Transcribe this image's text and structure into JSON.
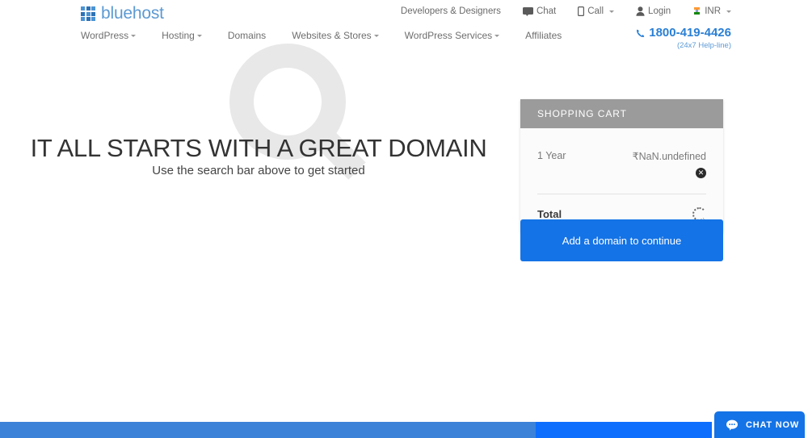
{
  "brand": {
    "name": "bluehost",
    "logo_icon": "grid-squares-icon",
    "accent": "#1473e6",
    "logo_color": "#5c9ad2"
  },
  "top_bar": {
    "items": [
      {
        "label": "Developers & Designers",
        "icon": null,
        "caret": false
      },
      {
        "label": "Chat",
        "icon": "chat-bubble-icon",
        "caret": false
      },
      {
        "label": "Call",
        "icon": "mobile-phone-icon",
        "caret": true
      },
      {
        "label": "Login",
        "icon": "user-person-icon",
        "caret": false
      },
      {
        "label": "INR",
        "icon": "india-flag-icon",
        "caret": true
      }
    ]
  },
  "main_nav": {
    "items": [
      {
        "label": "WordPress",
        "caret": true
      },
      {
        "label": "Hosting",
        "caret": true
      },
      {
        "label": "Domains",
        "caret": false
      },
      {
        "label": "Websites & Stores",
        "caret": true
      },
      {
        "label": "WordPress Services",
        "caret": true
      },
      {
        "label": "Affiliates",
        "caret": false
      }
    ]
  },
  "phone": {
    "icon": "phone-handset-icon",
    "number": "1800-419-4426",
    "subtext": "(24x7 Help-line)",
    "color": "#2a7fd4"
  },
  "hero": {
    "watermark_icon": "magnifying-glass-watermark",
    "title": "IT ALL STARTS WITH A GREAT DOMAIN",
    "subtitle": "Use the search bar above to get started"
  },
  "cart": {
    "header": "SHOPPING CART",
    "header_bg": "#9b9b9b",
    "line_item": {
      "term": "1 Year",
      "price": "₹NaN.undefined",
      "remove_icon": "close-circle-icon",
      "remove_glyph": "✕"
    },
    "total_label": "Total",
    "total_state_icon": "loading-spinner-icon",
    "cta_label": "Add a domain to continue"
  },
  "chat_widget": {
    "label": "CHAT NOW",
    "icon": "chat-bubble-icon"
  },
  "footer_strip": {
    "left_color": "#3b82d8",
    "right_color": "#0d6efd"
  }
}
